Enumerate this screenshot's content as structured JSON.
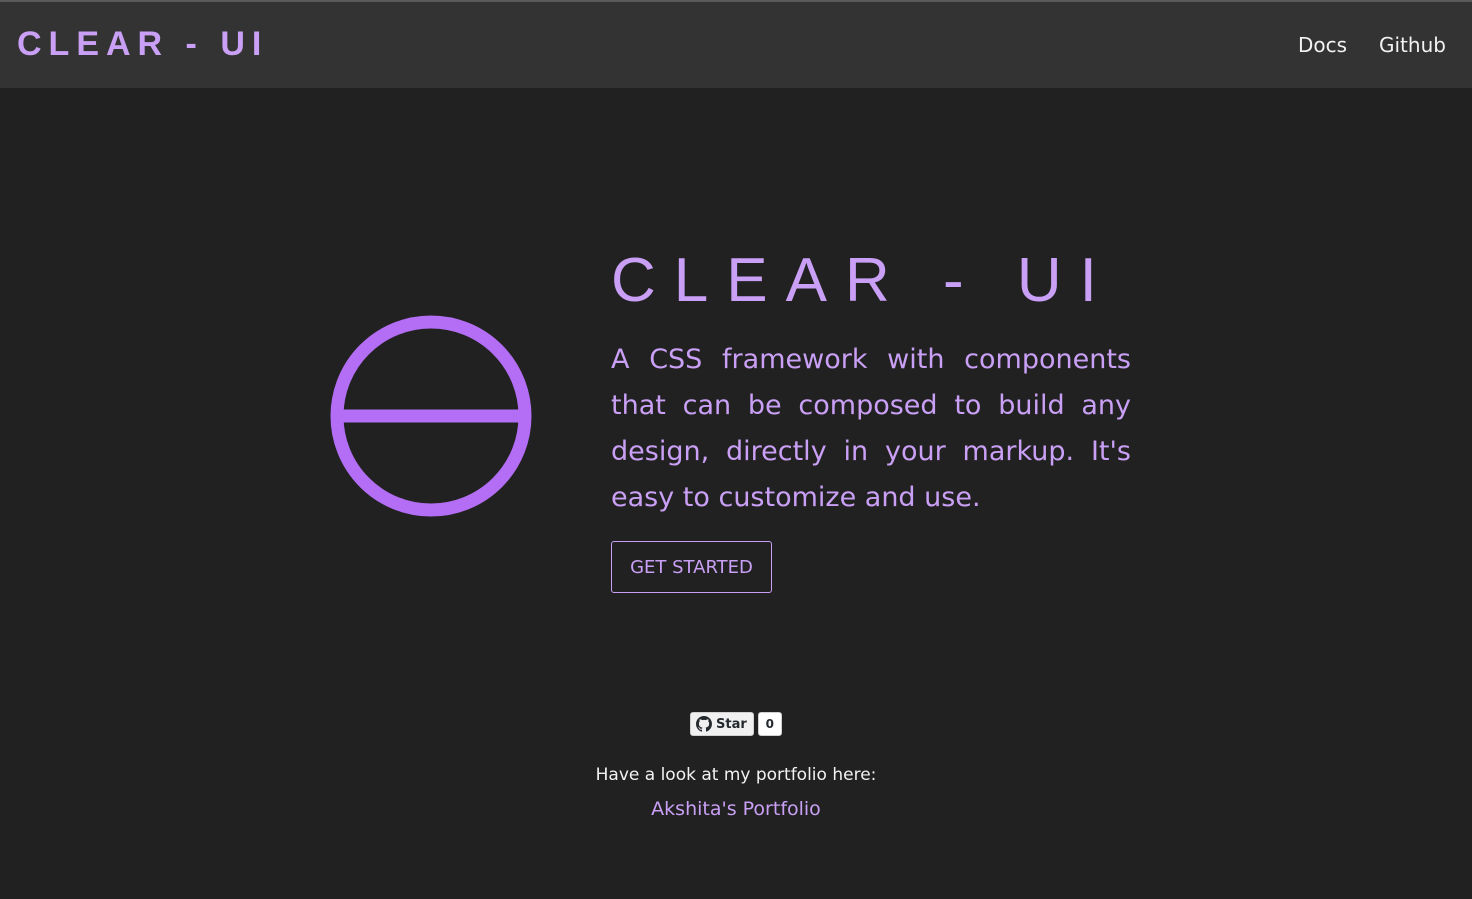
{
  "navbar": {
    "brand": "CLEAR - UI",
    "links": [
      {
        "label": "Docs"
      },
      {
        "label": "Github"
      }
    ]
  },
  "hero": {
    "title": "CLEAR - UI",
    "description": "A CSS framework with components that can be composed to build any design, directly in your markup. It's easy to customize and use.",
    "cta_label": "GET STARTED",
    "logo_icon": "circle-bisected-logo-icon"
  },
  "github_star": {
    "label": "Star",
    "count": "0",
    "icon": "github-icon"
  },
  "footer": {
    "portfolio_text": "Have a look at my portfolio here:",
    "portfolio_link": "Akshita's Portfolio"
  },
  "colors": {
    "accent": "#c9a0f5",
    "logo": "#b36ef5",
    "background": "#212121",
    "navbar": "#333333",
    "nav_text": "#f2f2f2"
  }
}
